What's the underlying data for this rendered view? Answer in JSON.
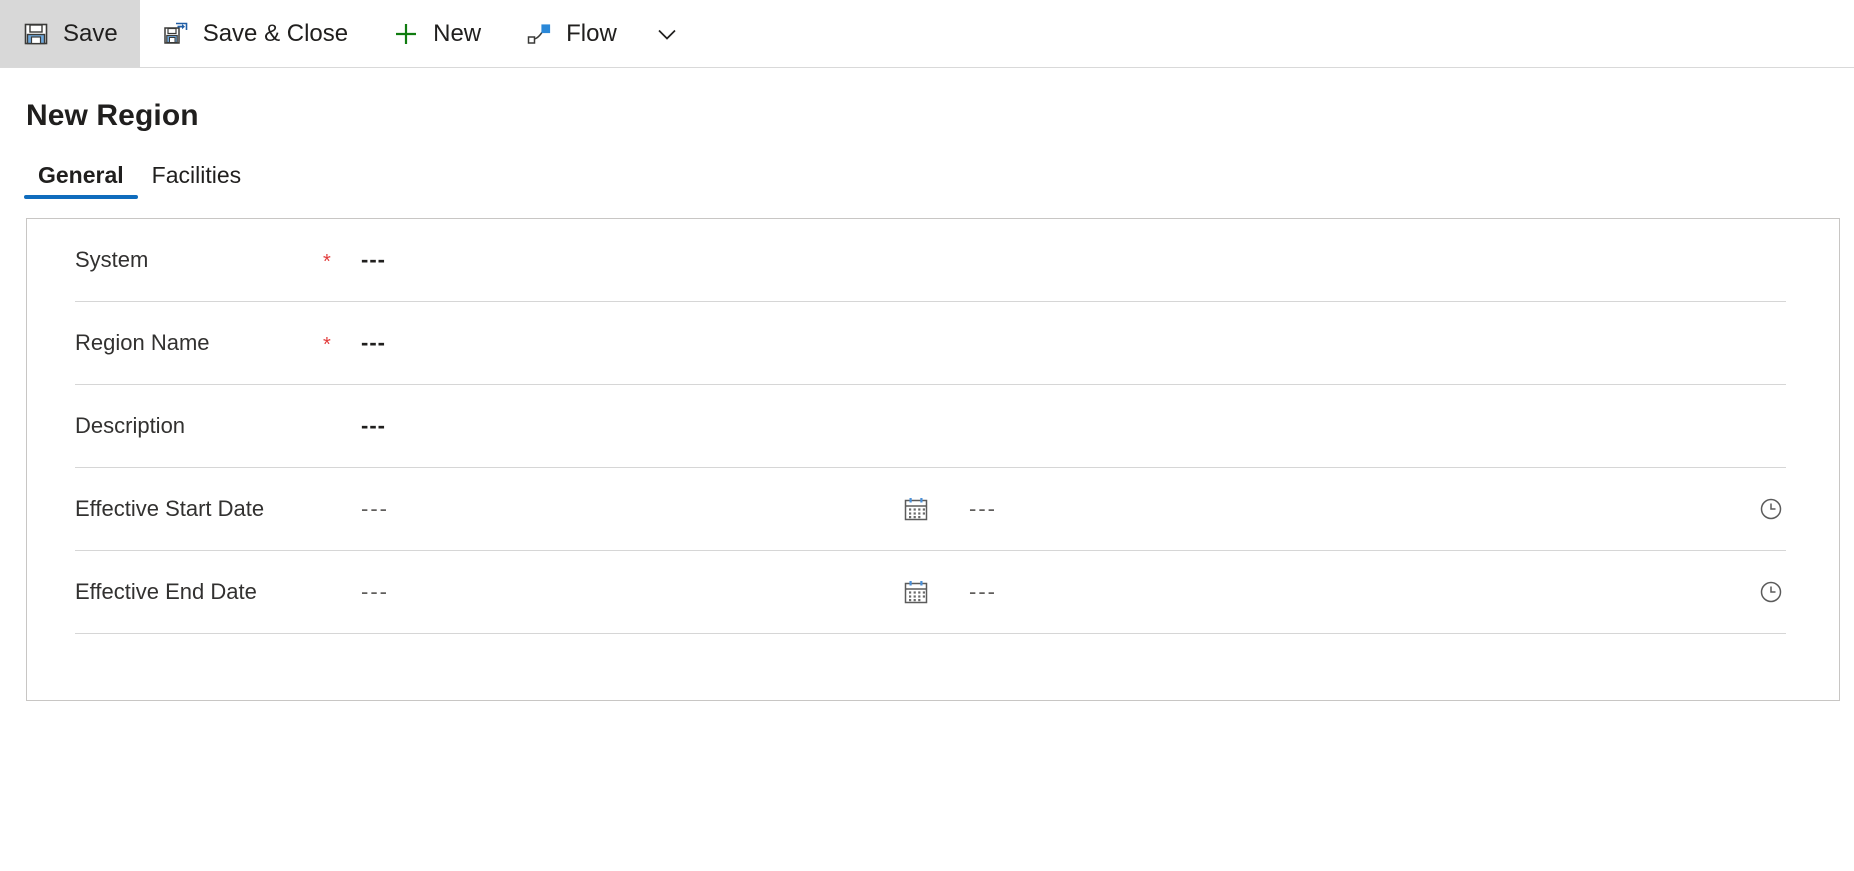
{
  "command_bar": {
    "buttons": [
      {
        "label": "Save",
        "icon": "save-icon",
        "selected": true
      },
      {
        "label": "Save & Close",
        "icon": "save-and-close-icon",
        "selected": false
      },
      {
        "label": "New",
        "icon": "plus-icon",
        "selected": false
      },
      {
        "label": "Flow",
        "icon": "flow-icon",
        "selected": false
      }
    ],
    "overflow_icon": "chevron-down-icon"
  },
  "page": {
    "title": "New Region"
  },
  "tabs": [
    {
      "label": "General",
      "active": true
    },
    {
      "label": "Facilities",
      "active": false
    }
  ],
  "form": {
    "rows": [
      {
        "label": "System",
        "required": true,
        "value": "---",
        "type": "lookup"
      },
      {
        "label": "Region Name",
        "required": true,
        "value": "---",
        "type": "text"
      },
      {
        "label": "Description",
        "required": false,
        "value": "---",
        "type": "text"
      },
      {
        "label": "Effective Start Date",
        "required": false,
        "date_value": "---",
        "time_value": "---",
        "date_icon": "calendar-icon",
        "time_icon": "clock-icon",
        "type": "datetime"
      },
      {
        "label": "Effective End Date",
        "required": false,
        "date_value": "---",
        "time_value": "---",
        "date_icon": "calendar-icon",
        "time_icon": "clock-icon",
        "type": "datetime"
      }
    ],
    "required_marker": "*"
  },
  "colors": {
    "accent": "#0f6cbd",
    "required": "#e23c3c",
    "icon_blue": "#4a90d9",
    "icon_green": "#107c10",
    "border": "#c8c6c4",
    "selected_bg": "#d8d8d8"
  }
}
